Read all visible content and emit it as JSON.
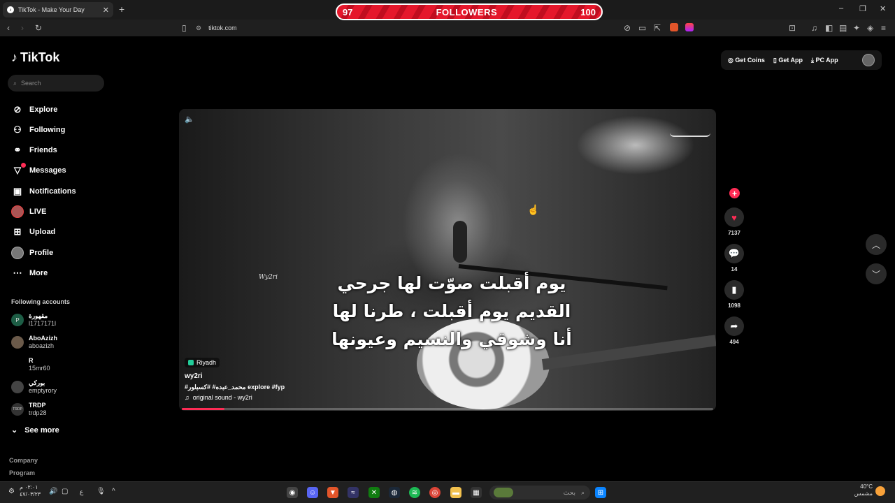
{
  "browser": {
    "tab_title": "TikTok - Make Your Day",
    "tab_close": "✕",
    "new_tab": "+",
    "url": "tiktok.com",
    "window_controls": [
      "–",
      "❐",
      "✕"
    ]
  },
  "overlay": {
    "left_value": "97",
    "label": "FOLLOWERS",
    "right_value": "100"
  },
  "sidebar": {
    "logo": "TikTok",
    "search_placeholder": "Search",
    "nav": [
      {
        "label": "Explore",
        "icon": "compass-icon",
        "glyph": "⊘"
      },
      {
        "label": "Following",
        "icon": "following-icon",
        "glyph": "⚇"
      },
      {
        "label": "Friends",
        "icon": "friends-icon",
        "glyph": "👥"
      },
      {
        "label": "Messages",
        "icon": "messages-icon",
        "glyph": "▽"
      },
      {
        "label": "Notifications",
        "icon": "notifications-icon",
        "glyph": "▣"
      },
      {
        "label": "LIVE",
        "icon": "live-avatar",
        "glyph": ""
      },
      {
        "label": "Upload",
        "icon": "upload-icon",
        "glyph": "⊞"
      },
      {
        "label": "Profile",
        "icon": "profile-avatar",
        "glyph": ""
      },
      {
        "label": "More",
        "icon": "more-icon",
        "glyph": "⋯"
      }
    ],
    "following_title": "Following accounts",
    "accounts": [
      {
        "name": "مقهورة",
        "handle": "l1717171l",
        "initial": "P"
      },
      {
        "name": "AboAzizh",
        "handle": "aboazizh",
        "initial": ""
      },
      {
        "name": "R",
        "handle": "15mr60",
        "initial": ""
      },
      {
        "name": "بوركي",
        "handle": "emptyrory",
        "initial": ""
      },
      {
        "name": "TRDP",
        "handle": "trdp28",
        "initial": "TRDP"
      }
    ],
    "see_more": "See more",
    "footer": [
      "Company",
      "Program"
    ]
  },
  "header_right": {
    "get_coins": "Get Coins",
    "get_app": "Get App",
    "pc_app": "PC App"
  },
  "video": {
    "signature": "Wy2ri",
    "lyrics": [
      "يوم أقبلت صوّت لها جرحي",
      "القديم يوم أقبلت ، طرنا لها",
      "أنا وشوقي والنسيم وعيونها"
    ],
    "location": "Riyadh",
    "author": "wy2ri",
    "tags": "#محمد_عبده# #كسبلور explore #fyp",
    "sound": "original sound - wy2ri",
    "progress": 0.08
  },
  "actions": {
    "likes": "7137",
    "comments": "14",
    "saves": "1098",
    "shares": "494"
  },
  "taskbar": {
    "clock_time": "٠٢:٠١ م",
    "clock_date": "٤٧/٠٣/٢٣",
    "lang": "ع",
    "search_placeholder": "بحث",
    "weather_temp": "40°C",
    "weather_desc": "مشمس"
  }
}
